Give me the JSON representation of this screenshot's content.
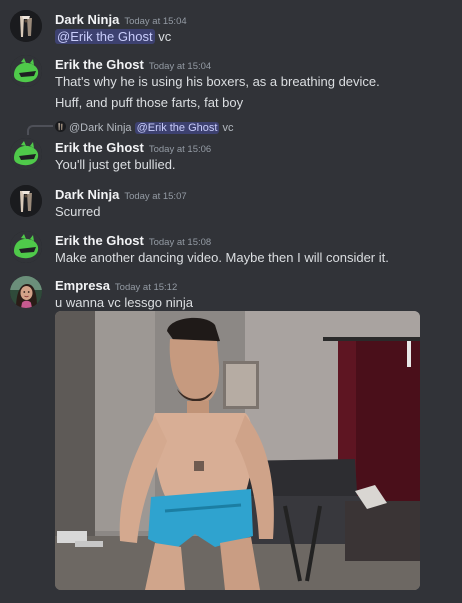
{
  "messages": [
    {
      "author": "Dark Ninja",
      "timestamp": "Today at 15:04",
      "mention": "@Erik the Ghost",
      "text_after_mention": " vc"
    },
    {
      "author": "Erik the Ghost",
      "timestamp": "Today at 15:04",
      "lines": [
        "That's why he is using his boxers, as a breathing device.",
        "Huff, and puff those farts, fat boy"
      ]
    },
    {
      "reply": {
        "author": "@Dark Ninja",
        "mention": "@Erik the Ghost",
        "text": " vc"
      },
      "author": "Erik the Ghost",
      "timestamp": "Today at 15:06",
      "text": "You'll just get bullied."
    },
    {
      "author": "Dark Ninja",
      "timestamp": "Today at 15:07",
      "text": "Scurred"
    },
    {
      "author": "Erik the Ghost",
      "timestamp": "Today at 15:08",
      "text": "Make another dancing video. Maybe then I will consider it."
    },
    {
      "author": "Empresa",
      "timestamp": "Today at 15:12",
      "text": "u wanna vc lessgo ninja"
    }
  ],
  "colors": {
    "background": "#313338",
    "author": "#f2f3f5",
    "timestamp": "#949ba4",
    "text": "#dbdee1",
    "mention_bg": "#3c4270",
    "mention_text": "#c9cdfb",
    "erik_avatar": "#4fc94a"
  },
  "icons": {
    "dark_ninja_avatar": "ninja-avatar-icon",
    "erik_avatar": "green-blob-avatar-icon",
    "empresa_avatar": "empresa-avatar-icon"
  }
}
